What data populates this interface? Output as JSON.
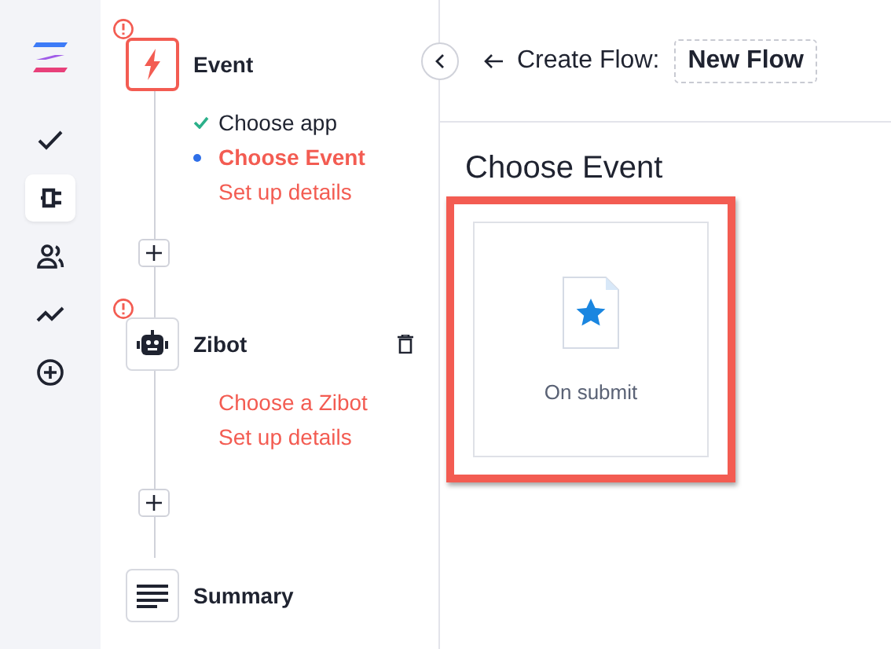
{
  "rail": {
    "items": [
      {
        "kind": "check",
        "selected": false
      },
      {
        "kind": "plug",
        "selected": true
      },
      {
        "kind": "users",
        "selected": false
      },
      {
        "kind": "trend",
        "selected": false
      },
      {
        "kind": "add",
        "selected": false
      }
    ]
  },
  "steps": [
    {
      "kind": "event",
      "title": "Event",
      "error": true,
      "active": true,
      "deletable": false,
      "substeps": [
        {
          "label": "Choose app",
          "kind": "done"
        },
        {
          "label": "Choose Event",
          "kind": "current"
        },
        {
          "label": "Set up details",
          "kind": "pending"
        }
      ]
    },
    {
      "kind": "bot",
      "title": "Zibot",
      "error": true,
      "active": false,
      "deletable": true,
      "substeps": [
        {
          "label": "Choose a Zibot",
          "kind": "pending"
        },
        {
          "label": "Set up details",
          "kind": "pending"
        }
      ]
    },
    {
      "kind": "summary",
      "title": "Summary",
      "error": false,
      "active": false,
      "deletable": false
    }
  ],
  "header": {
    "prefix": "Create Flow:",
    "name": "New Flow"
  },
  "main": {
    "title": "Choose Event",
    "options": [
      {
        "label": "On submit",
        "selected": true
      }
    ]
  }
}
